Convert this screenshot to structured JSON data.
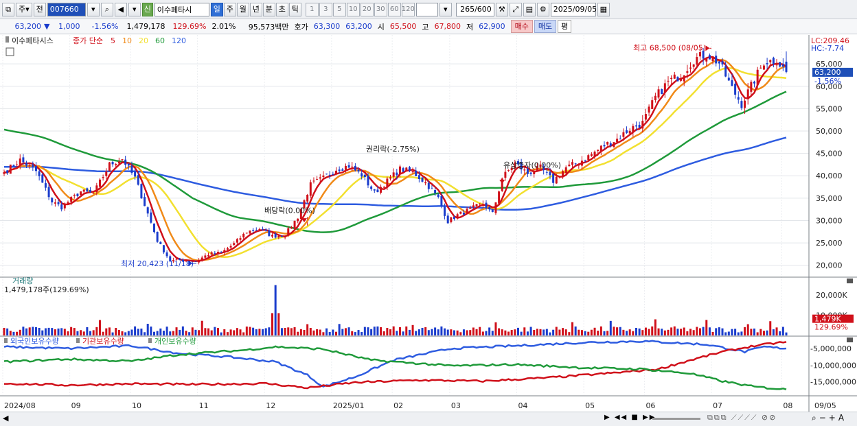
{
  "toolbar": {
    "market": "주",
    "prev_label": "전",
    "code": "007660",
    "name_badge": "신",
    "stock_name": "이수페타시",
    "periods": [
      "일",
      "주",
      "월",
      "년",
      "분",
      "초",
      "틱"
    ],
    "active_period": "일",
    "minutes": [
      "1",
      "3",
      "5",
      "10",
      "20",
      "30",
      "60",
      "120"
    ],
    "count": "265",
    "count_total": "/600",
    "date": "2025/09/05"
  },
  "quote": {
    "price": "63,200",
    "arrow": "▼",
    "change": "1,000",
    "change_pct": "-1.56%",
    "volume": "1,479,178",
    "vol_ratio": "129.69%",
    "turnover": "2.01%",
    "amount": "95,573백만",
    "hoga_label": "호가",
    "ask": "63,300",
    "bid": "63,200",
    "open_label": "시",
    "open": "65,500",
    "high_label": "고",
    "high": "67,800",
    "low_label": "저",
    "low": "62,900",
    "buy_btn": "매수",
    "sell_btn": "매도",
    "avg_btn": "평"
  },
  "chart_data": {
    "type": "candlestick",
    "stock": "이수페타시스",
    "legend": {
      "label": "종가 단순",
      "ma": [
        {
          "period": "5",
          "color": "#d0101a"
        },
        {
          "period": "10",
          "color": "#f08a18"
        },
        {
          "period": "20",
          "color": "#f2e030"
        },
        {
          "period": "60",
          "color": "#1f9a3a"
        },
        {
          "period": "120",
          "color": "#2e5ce0"
        }
      ]
    },
    "y_ticks": [
      "65,000",
      "60,000",
      "55,000",
      "50,000",
      "45,000",
      "40,000",
      "35,000",
      "30,000",
      "25,000",
      "20,000"
    ],
    "y_range": [
      17500,
      71000
    ],
    "lc": "LC:209.46",
    "hc": "HC:-7.74",
    "last_price": "63,200",
    "last_pct": "-1.56%",
    "x_labels": [
      "2024/08",
      "09",
      "10",
      "11",
      "12",
      "2025/01",
      "02",
      "03",
      "04",
      "05",
      "06",
      "07",
      "08",
      "09",
      "09/05"
    ],
    "close_anchors": [
      [
        0,
        40800
      ],
      [
        5,
        43500
      ],
      [
        10,
        41000
      ],
      [
        15,
        34200
      ],
      [
        18,
        33000
      ],
      [
        24,
        36500
      ],
      [
        28,
        36000
      ],
      [
        33,
        42500
      ],
      [
        37,
        43800
      ],
      [
        41,
        39500
      ],
      [
        45,
        31500
      ],
      [
        48,
        25500
      ],
      [
        52,
        21000
      ],
      [
        56,
        21200
      ],
      [
        60,
        20900
      ],
      [
        64,
        22500
      ],
      [
        68,
        22800
      ],
      [
        72,
        24800
      ],
      [
        76,
        27500
      ],
      [
        80,
        28200
      ],
      [
        84,
        26500
      ],
      [
        88,
        26800
      ],
      [
        92,
        30800
      ],
      [
        96,
        38000
      ],
      [
        100,
        39500
      ],
      [
        104,
        41500
      ],
      [
        108,
        42200
      ],
      [
        112,
        40200
      ],
      [
        116,
        36200
      ],
      [
        120,
        38800
      ],
      [
        124,
        41500
      ],
      [
        128,
        40800
      ],
      [
        132,
        38500
      ],
      [
        136,
        35000
      ],
      [
        139,
        29800
      ],
      [
        142,
        31200
      ],
      [
        146,
        32500
      ],
      [
        150,
        33800
      ],
      [
        153,
        31500
      ],
      [
        156,
        39500
      ],
      [
        160,
        42800
      ],
      [
        164,
        40500
      ],
      [
        168,
        41800
      ],
      [
        172,
        38800
      ],
      [
        176,
        41800
      ],
      [
        180,
        43000
      ],
      [
        184,
        44800
      ],
      [
        188,
        46800
      ],
      [
        192,
        48200
      ],
      [
        196,
        50500
      ],
      [
        200,
        51800
      ],
      [
        204,
        57500
      ],
      [
        208,
        61000
      ],
      [
        212,
        62500
      ],
      [
        216,
        66000
      ],
      [
        220,
        67200
      ],
      [
        224,
        65200
      ],
      [
        228,
        59500
      ],
      [
        231,
        56000
      ],
      [
        234,
        60000
      ],
      [
        238,
        65500
      ],
      [
        242,
        65800
      ],
      [
        245,
        63200
      ]
    ],
    "annotations": [
      {
        "text": "최고 68,500 (08/05)",
        "type": "high"
      },
      {
        "text": "최저 20,423 (11/18)",
        "type": "low"
      },
      {
        "text": "배당락(0.00%)",
        "type": "event"
      },
      {
        "text": "권리락(-2.75%)",
        "type": "event"
      },
      {
        "text": "유상증자(0.00%)",
        "type": "event"
      }
    ],
    "volume_panel": {
      "title": "거래량",
      "value": "1,479,178주(129.69%)",
      "y_ticks": [
        "20,000K",
        "10,000K"
      ],
      "last": "1,479K",
      "last_pct": "129.69%"
    },
    "holdings_panel": {
      "series": [
        {
          "name": "외국인보유수량",
          "color": "#2e5ce0"
        },
        {
          "name": "기관보유수량",
          "color": "#d0101a"
        },
        {
          "name": "개인보유수량",
          "color": "#1f9a3a"
        }
      ],
      "y_ticks": [
        "-5,000,000",
        "-10,000,000",
        "-15,000,000"
      ],
      "y_range": [
        -19000000,
        -1500000
      ]
    }
  }
}
